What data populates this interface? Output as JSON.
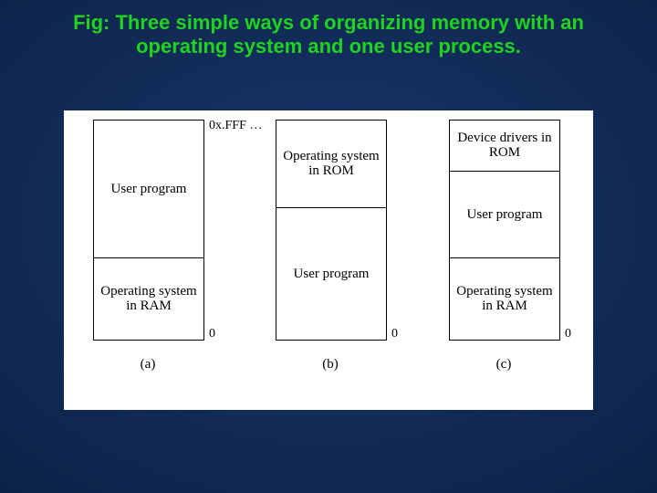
{
  "title": "Fig: Three simple ways of organizing memory with an operating system and one user process.",
  "addr_top": "0x.FFF …",
  "addr_bottom": "0",
  "segments": {
    "user_program": "User\nprogram",
    "os_ram": "Operating\nsystem in\nRAM",
    "os_rom": "Operating\nsystem in\nROM",
    "drivers_rom": "Device\ndrivers in ROM"
  },
  "captions": {
    "a": "(a)",
    "b": "(b)",
    "c": "(c)"
  }
}
